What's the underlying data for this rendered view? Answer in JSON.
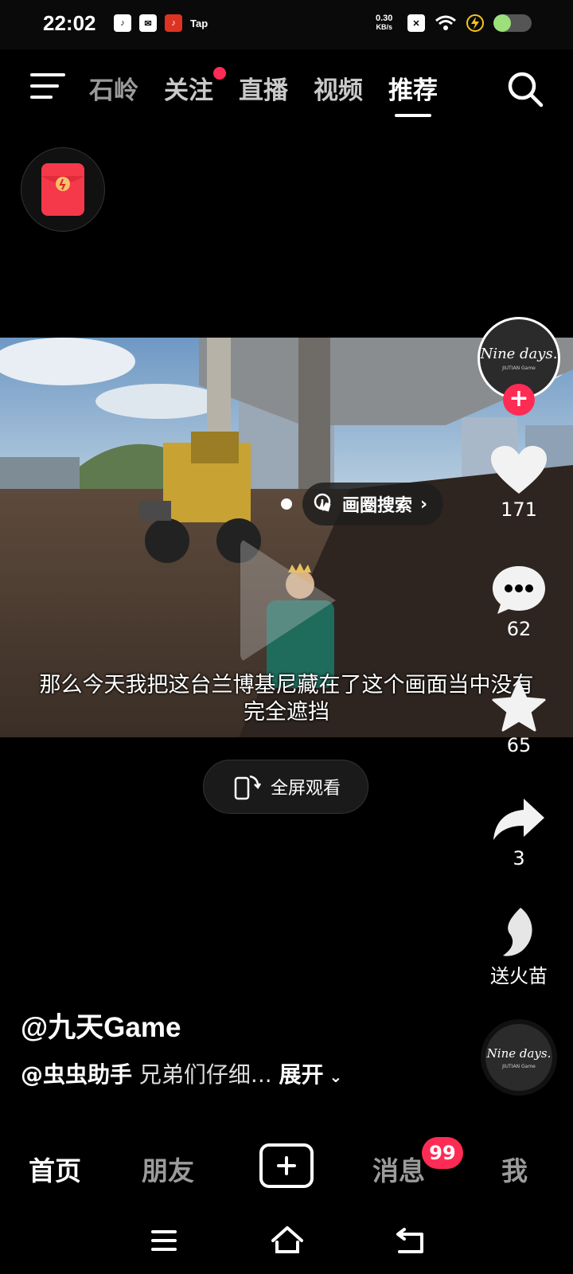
{
  "status_bar": {
    "time": "22:02",
    "app_icons": [
      "tiktok-icon",
      "mail-icon",
      "tiktok-lite-icon"
    ],
    "tap_label": "Tap",
    "net_speed_value": "0.30",
    "net_speed_unit": "KB/s",
    "battery_level": 0.45
  },
  "top_nav": {
    "tabs": [
      {
        "label": "石岭",
        "active": false
      },
      {
        "label": "关注",
        "active": false,
        "has_dot": true
      },
      {
        "label": "直播",
        "active": false
      },
      {
        "label": "视频",
        "active": false
      },
      {
        "label": "推荐",
        "active": true
      }
    ]
  },
  "video": {
    "circle_search_label": "画圈搜索",
    "subtitle_line1": "那么今天我把这台兰博基尼藏在了这个画面当中没有",
    "subtitle_line2": "完全遮挡",
    "fullscreen_label": "全屏观看"
  },
  "right_rail": {
    "avatar_text": "Nine days.",
    "avatar_subtext": "JIUTIAN Game",
    "likes": "171",
    "comments": "62",
    "favorites": "65",
    "shares": "3",
    "gift_label": "送火苗"
  },
  "caption": {
    "author": "@九天Game",
    "mention": "@虫虫助手",
    "text": "兄弟们仔细...",
    "expand_label": "展开"
  },
  "bottom_nav": {
    "home": "首页",
    "friends": "朋友",
    "messages": "消息",
    "messages_badge": "99",
    "me": "我"
  },
  "colors": {
    "accent": "#fe2c55",
    "background": "#000000"
  }
}
